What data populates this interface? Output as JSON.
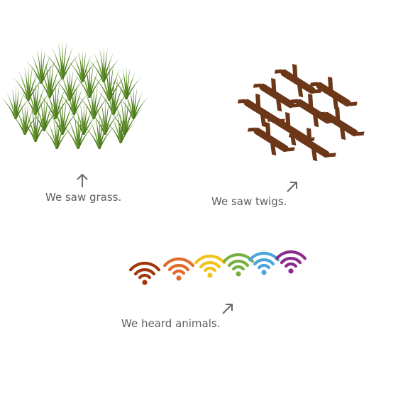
{
  "captions": {
    "grass": "We saw grass.",
    "twigs": "We saw twigs.",
    "animals": "We heard animals."
  },
  "icons": {
    "grass": "grass-icon",
    "twigs": "twig-icon",
    "sound": "wifi-signal-icon",
    "arrow_up": "arrow-up-icon",
    "arrow_up_right": "arrow-up-right-icon"
  },
  "colors": {
    "grass": "#4e7a20",
    "grass_light": "#6c9b30",
    "twig": "#6b3718",
    "caption": "#5f5f5f",
    "arrow": "#6a6a6a",
    "signals": [
      "#a0360e",
      "#e26a2c",
      "#f1c21b",
      "#78b040",
      "#4aa6dc",
      "#8a2a8c"
    ]
  }
}
